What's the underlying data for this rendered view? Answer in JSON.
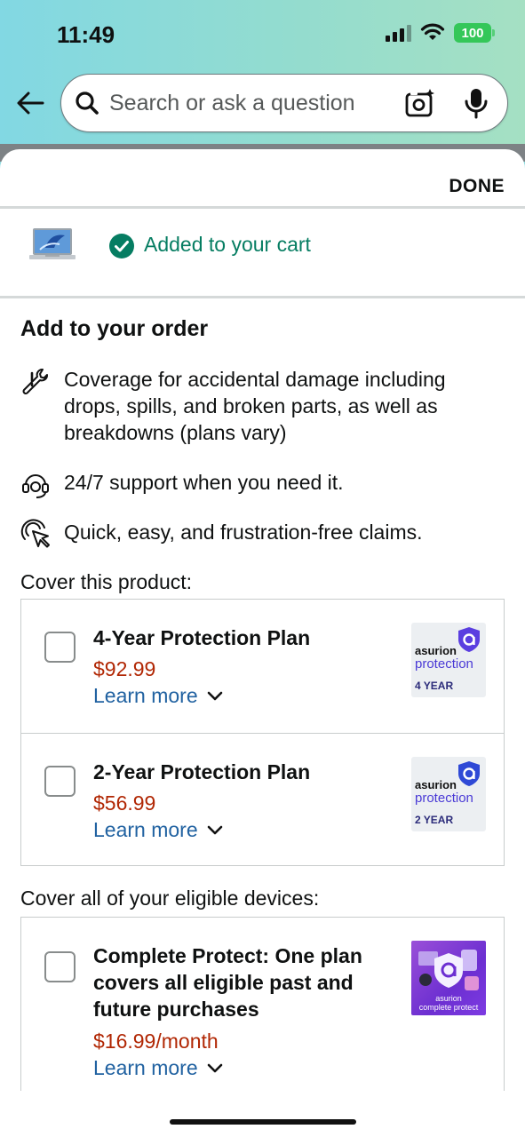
{
  "status_bar": {
    "time": "11:49",
    "battery": "100"
  },
  "search": {
    "placeholder": "Search or ask a question"
  },
  "sheet": {
    "done_label": "DONE",
    "added_message": "Added to your cart",
    "section_title": "Add to your order",
    "benefits": [
      {
        "icon": "wrench-icon",
        "text": "Coverage for accidental damage including drops, spills, and broken parts, as well as breakdowns (plans vary)"
      },
      {
        "icon": "headset-icon",
        "text": "24/7 support when you need it."
      },
      {
        "icon": "tap-icon",
        "text": "Quick, easy, and frustration-free claims."
      }
    ],
    "cover_product_label": "Cover this product:",
    "plans": [
      {
        "name": "4-Year Protection Plan",
        "price": "$92.99",
        "learn_more": "Learn more",
        "logo_brand": "asurion",
        "logo_product": "protection",
        "logo_years": "4 YEAR"
      },
      {
        "name": "2-Year Protection Plan",
        "price": "$56.99",
        "learn_more": "Learn more",
        "logo_brand": "asurion",
        "logo_product": "protection",
        "logo_years": "2 YEAR"
      }
    ],
    "cover_all_label": "Cover all of your eligible devices:",
    "complete_protect": {
      "name": "Complete Protect: One plan covers all eligible past and future purchases",
      "price": "$16.99/month",
      "learn_more": "Learn more",
      "logo_brand": "asurion",
      "logo_product": "complete protect"
    }
  },
  "colors": {
    "success_green": "#067d62",
    "price_red": "#b12704",
    "link_blue": "#2162a1",
    "asurion_purple": "#4a3ad6"
  }
}
